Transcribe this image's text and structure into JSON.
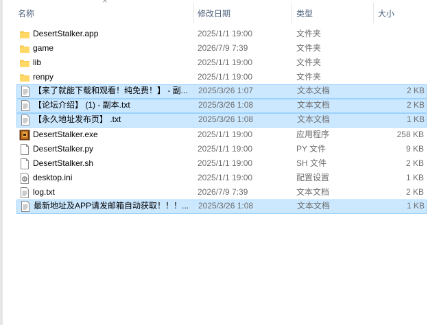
{
  "header": {
    "name": "名称",
    "date": "修改日期",
    "type": "类型",
    "size": "大小",
    "sort_arrow": "^"
  },
  "files": [
    {
      "name": "DesertStalker.app",
      "date": "2025/1/1 19:00",
      "type": "文件夹",
      "size": "",
      "icon": "folder-icon",
      "selected": false
    },
    {
      "name": "game",
      "date": "2026/7/9 7:39",
      "type": "文件夹",
      "size": "",
      "icon": "folder-icon",
      "selected": false
    },
    {
      "name": "lib",
      "date": "2025/1/1 19:00",
      "type": "文件夹",
      "size": "",
      "icon": "folder-icon",
      "selected": false
    },
    {
      "name": "renpy",
      "date": "2025/1/1 19:00",
      "type": "文件夹",
      "size": "",
      "icon": "folder-icon",
      "selected": false
    },
    {
      "name": "【来了就能下载和观看！纯免费！】 - 副...",
      "date": "2025/3/26 1:07",
      "type": "文本文档",
      "size": "2 KB",
      "icon": "text-file-icon",
      "selected": true
    },
    {
      "name": "【论坛介绍】 (1) - 副本.txt",
      "date": "2025/3/26 1:08",
      "type": "文本文档",
      "size": "2 KB",
      "icon": "text-file-icon",
      "selected": true
    },
    {
      "name": "【永久地址发布页】 .txt",
      "date": "2025/3/26 1:08",
      "type": "文本文档",
      "size": "1 KB",
      "icon": "text-file-icon",
      "selected": true
    },
    {
      "name": "DesertStalker.exe",
      "date": "2025/1/1 19:00",
      "type": "应用程序",
      "size": "258 KB",
      "icon": "application-icon",
      "selected": false
    },
    {
      "name": "DesertStalker.py",
      "date": "2025/1/1 19:00",
      "type": "PY 文件",
      "size": "9 KB",
      "icon": "blank-file-icon",
      "selected": false
    },
    {
      "name": "DesertStalker.sh",
      "date": "2025/1/1 19:00",
      "type": "SH 文件",
      "size": "2 KB",
      "icon": "blank-file-icon",
      "selected": false
    },
    {
      "name": "desktop.ini",
      "date": "2025/1/1 19:00",
      "type": "配置设置",
      "size": "1 KB",
      "icon": "settings-file-icon",
      "selected": false
    },
    {
      "name": "log.txt",
      "date": "2026/7/9 7:39",
      "type": "文本文档",
      "size": "2 KB",
      "icon": "text-file-icon",
      "selected": false
    },
    {
      "name": "最新地址及APP请发邮箱自动获取！！！...",
      "date": "2025/3/26 1:08",
      "type": "文本文档",
      "size": "1 KB",
      "icon": "text-file-icon",
      "selected": true
    }
  ]
}
